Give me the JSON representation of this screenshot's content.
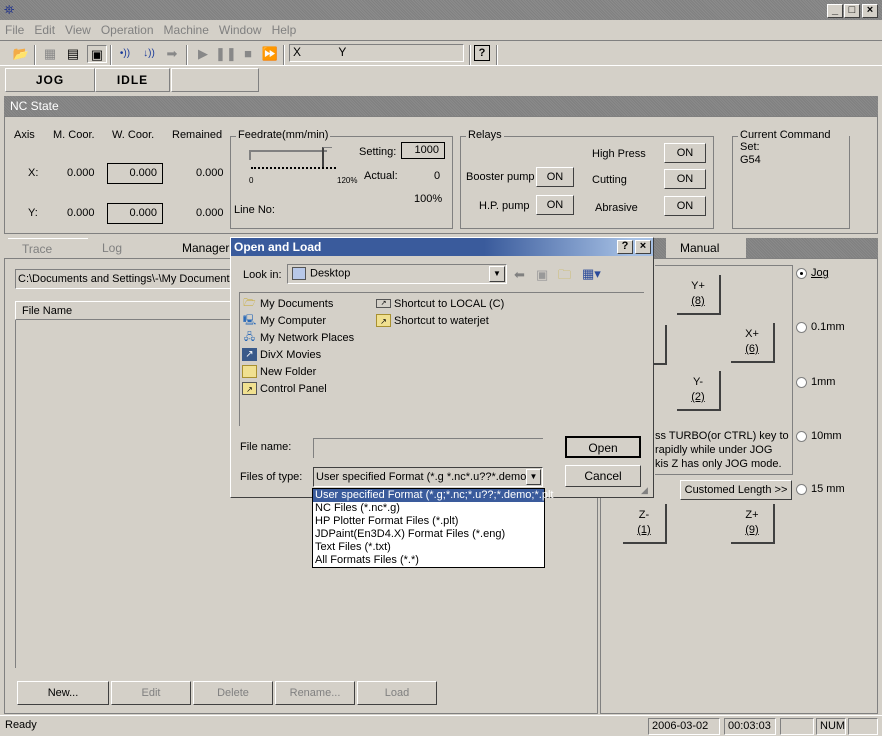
{
  "window": {
    "minimize": "_",
    "maximize": "□",
    "close": "×"
  },
  "menu": [
    "File",
    "Edit",
    "View",
    "Operation",
    "Machine",
    "Window",
    "Help"
  ],
  "toolbar": {
    "icons": [
      "open-folder-icon",
      "edit-program-icon",
      "list-icon",
      "handshake-icon",
      "signal-icon",
      "signal-in-icon",
      "export-icon",
      "play-icon",
      "pause-icon",
      "stop-icon",
      "step-icon"
    ],
    "xy_label_x": "X",
    "xy_label_y": "Y",
    "help_glyph": "?"
  },
  "state": {
    "mode": "JOG",
    "status": "IDLE"
  },
  "nc_state": {
    "title": "NC State",
    "headers": [
      "Axis",
      "M. Coor.",
      "W. Coor.",
      "Remained"
    ],
    "rows": [
      {
        "axis": "X:",
        "m": "0.000",
        "w": "0.000",
        "r": "0.000"
      },
      {
        "axis": "Y:",
        "m": "0.000",
        "w": "0.000",
        "r": "0.000"
      }
    ],
    "feedrate": {
      "title": "Feedrate(mm/min)",
      "slider_min": "0",
      "slider_max": "120%",
      "slider_value_percent": 100,
      "setting_label": "Setting:",
      "setting_value": "1000",
      "actual_label": "Actual:",
      "actual_value": "0",
      "percent": "100%",
      "line_no_label": "Line No:"
    },
    "relays": {
      "title": "Relays",
      "items": [
        {
          "label": "High Press",
          "value": "ON"
        },
        {
          "label": "Booster pump",
          "value": "ON"
        },
        {
          "label": "Cutting",
          "value": "ON"
        },
        {
          "label": "H.P. pump",
          "value": "ON"
        },
        {
          "label": "Abrasive",
          "value": "ON"
        }
      ]
    },
    "command_set": {
      "title": "Current Command Set:",
      "value": "G54"
    }
  },
  "left_tabs": [
    "Trace",
    "Log",
    "Manager"
  ],
  "manager": {
    "path": "C:\\Documents and Settings\\-\\My Documents",
    "column": "File Name",
    "buttons": [
      "New...",
      "Edit",
      "Delete",
      "Rename...",
      "Load"
    ]
  },
  "right_tabs": [
    "Manual"
  ],
  "manual": {
    "jog_buttons": [
      {
        "label": "Y+",
        "key": "(8)"
      },
      {
        "label": "X+",
        "key": "(6)"
      },
      {
        "label": "Y-",
        "key": "(2)"
      },
      {
        "label": "Z-",
        "key": "(1)"
      },
      {
        "label": "Z+",
        "key": "(9)"
      }
    ],
    "hint_lines": [
      "ss TURBO(or CTRL) key to",
      "rapidly while under JOG",
      "kis Z has only JOG mode."
    ],
    "custom_length": "Customed Length  >>",
    "radios": [
      {
        "label": "Jog",
        "checked": true
      },
      {
        "label": "0.1mm",
        "checked": false
      },
      {
        "label": "1mm",
        "checked": false
      },
      {
        "label": "10mm",
        "checked": false
      },
      {
        "label": "15  mm",
        "checked": false
      }
    ]
  },
  "dialog": {
    "title": "Open and Load",
    "help": "?",
    "close": "×",
    "look_in_label": "Look in:",
    "look_in_value": "Desktop",
    "files_col1": [
      {
        "name": "My Documents",
        "icon": "my-documents-icon"
      },
      {
        "name": "My Computer",
        "icon": "my-computer-icon"
      },
      {
        "name": "My Network Places",
        "icon": "network-places-icon"
      },
      {
        "name": "DivX Movies",
        "icon": "shortcut-icon"
      },
      {
        "name": "New Folder",
        "icon": "folder-icon"
      },
      {
        "name": "Control Panel",
        "icon": "control-panel-icon"
      }
    ],
    "files_col2": [
      {
        "name": "Shortcut to LOCAL (C)",
        "icon": "drive-shortcut-icon"
      },
      {
        "name": "Shortcut to waterjet",
        "icon": "folder-shortcut-icon"
      }
    ],
    "file_name_label": "File name:",
    "file_name_value": "",
    "file_type_label": "Files of type:",
    "file_type_value": "User specified Format (*.g *.nc*.u??*.demo:",
    "open": "Open",
    "cancel": "Cancel",
    "type_options": [
      "User specified Format (*.g;*.nc;*.u??;*.demo;*.plt",
      "NC Files (*.nc*.g)",
      "HP Plotter Format Files (*.plt)",
      "JDPaint(En3D4.X) Format Files (*.eng)",
      "Text Files (*.txt)",
      "All Formats Files (*.*)"
    ]
  },
  "statusbar": {
    "text": "Ready",
    "date": "2006-03-02",
    "time": "00:03:03",
    "num": "NUM"
  }
}
